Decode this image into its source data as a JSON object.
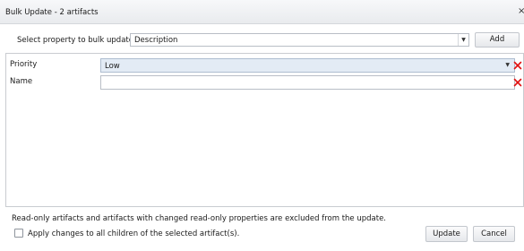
{
  "dialog": {
    "title": "Bulk Update - 2 artifacts",
    "close_glyph": "×"
  },
  "property_picker": {
    "label": "Select property to bulk update:",
    "selected": "Description",
    "add_label": "Add"
  },
  "properties": [
    {
      "label": "Priority",
      "value": "Low",
      "type": "dropdown"
    },
    {
      "label": "Name",
      "value": "",
      "type": "text"
    }
  ],
  "footer": {
    "note": "Read-only artifacts and artifacts with changed read-only properties are excluded from the update.",
    "checkbox_label": "Apply changes to all children of the selected artifact(s).",
    "checkbox_checked": false,
    "update_label": "Update",
    "cancel_label": "Cancel"
  },
  "icons": {
    "remove": "x-icon",
    "dropdown": "caret-down-icon"
  },
  "colors": {
    "remove_icon": "#e01010",
    "selected_field_bg": "#e3ebf5"
  }
}
